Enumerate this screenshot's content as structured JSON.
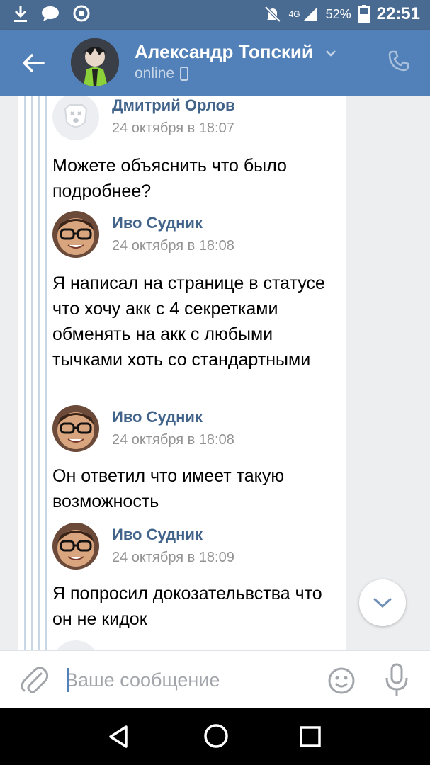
{
  "statusbar": {
    "network": "4G",
    "battery": "52%",
    "time": "22:51"
  },
  "header": {
    "contact_name": "Александр Топский",
    "status": "online"
  },
  "messages": [
    {
      "author": "Дмитрий Орлов",
      "date": "24 октября в 18:07",
      "text": "Можете объяснить что было подробнее?",
      "avatar": "vk-dog-avatar"
    },
    {
      "author": "Иво Судник",
      "date": "24 октября в 18:08",
      "text": "Я написал на странице в статусе что хочу акк с 4 секретками обменять на акк с любыми тычками хоть со стандартными",
      "avatar": "glasses-man-avatar"
    },
    {
      "author": "Иво Судник",
      "date": "24 октября в 18:08",
      "text": "Он ответил что имеет такую возможность",
      "avatar": "glasses-man-avatar"
    },
    {
      "author": "Иво Судник",
      "date": "24 октября в 18:09",
      "text": "Я попросил докозательвства что он не кидок",
      "avatar": "glasses-man-avatar"
    }
  ],
  "composer": {
    "placeholder": "Ваше сообщение"
  },
  "colors": {
    "header": "#5181b8",
    "statusbar": "#4a6b91",
    "author": "#42648b",
    "date": "#939393"
  }
}
